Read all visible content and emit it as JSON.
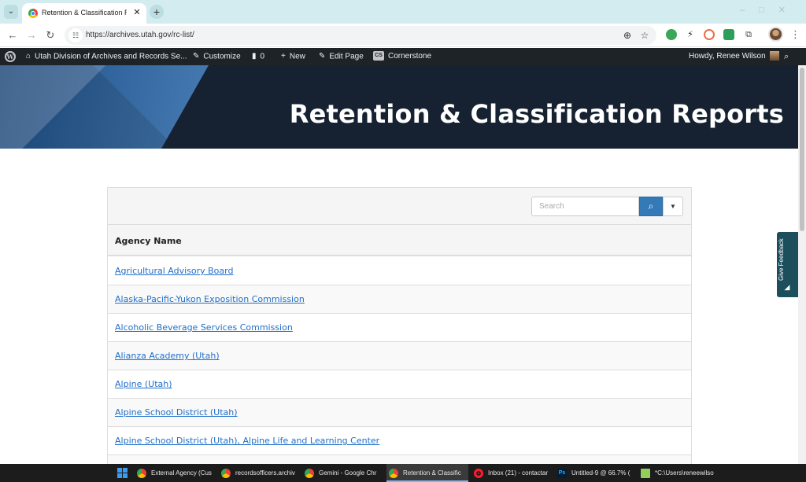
{
  "browser": {
    "tab_title": "Retention & Classification Reports",
    "tab_close": "✕",
    "new_tab": "+",
    "url": "https://archives.utah.gov/rc-list/"
  },
  "admin_bar": {
    "site_name": "Utah Division of Archives and Records Se...",
    "customize": "Customize",
    "comments_count": "0",
    "new": "New",
    "edit_page": "Edit Page",
    "cornerstone": "Cornerstone",
    "cornerstone_badge": "CS",
    "howdy": "Howdy, Renee Wilson"
  },
  "hero": {
    "title": "Retention & Classification Reports"
  },
  "table": {
    "search_placeholder": "Search",
    "column_header": "Agency Name",
    "rows": [
      "Agricultural Advisory Board",
      "Alaska-Pacific-Yukon Exposition Commission",
      "Alcoholic Beverage Services Commission",
      "Alianza Academy (Utah)",
      "Alpine (Utah)",
      "Alpine School District (Utah)",
      "Alpine School District (Utah), Alpine Life and Learning Center"
    ]
  },
  "feedback": {
    "label": "Give Feedback"
  },
  "taskbar": {
    "items": [
      "External Agency (Cus",
      "recordsofficers.archiv",
      "Gemini - Google Chr",
      "Retention & Classific",
      "Inbox (21) - contactar",
      "Untitled-9 @ 66.7% (",
      "*C:\\Users\\reneewilso"
    ],
    "ps_badge": "Ps"
  }
}
